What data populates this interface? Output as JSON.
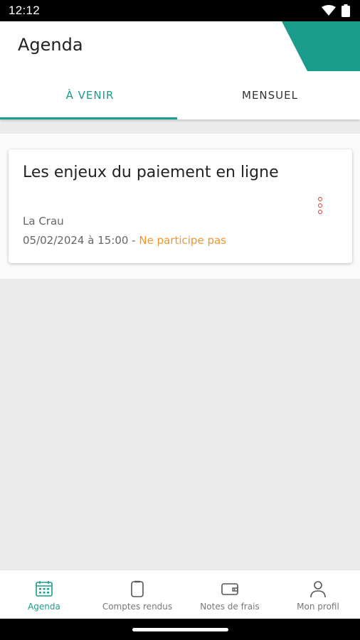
{
  "status_bar": {
    "time": "12:12"
  },
  "header": {
    "title": "Agenda"
  },
  "tabs": [
    {
      "label": "À VENIR",
      "active": true
    },
    {
      "label": "MENSUEL",
      "active": false
    }
  ],
  "events": [
    {
      "title": "Les enjeux du paiement en ligne",
      "location": "La Crau",
      "datetime": "05/02/2024 à 15:00 - ",
      "status": "Ne participe pas"
    }
  ],
  "bottom_nav": [
    {
      "label": "Agenda",
      "icon": "calendar-icon",
      "active": true
    },
    {
      "label": "Comptes rendus",
      "icon": "clipboard-icon",
      "active": false
    },
    {
      "label": "Notes de frais",
      "icon": "wallet-icon",
      "active": false
    },
    {
      "label": "Mon profil",
      "icon": "user-icon",
      "active": false
    }
  ],
  "colors": {
    "accent": "#1a9b8c",
    "status_declined": "#f0962e",
    "menu_dots": "#e53935"
  }
}
